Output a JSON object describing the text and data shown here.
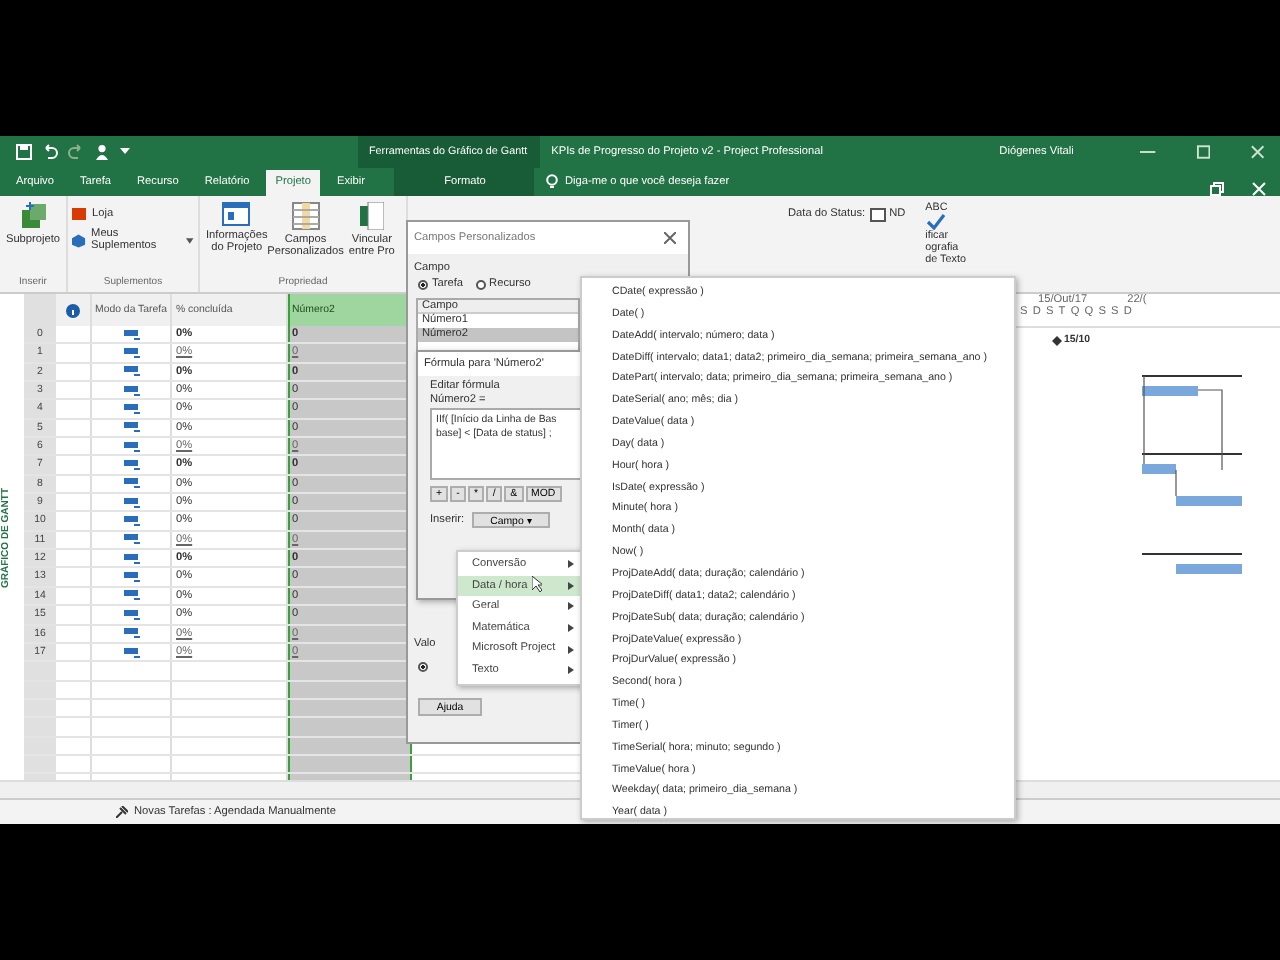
{
  "window": {
    "context_tab_group": "Ferramentas do Gráfico de Gantt",
    "title": "KPIs de Progresso do Projeto v2  -  Project Professional",
    "user": "Diógenes Vitali"
  },
  "ribbon_tabs": [
    {
      "label": "Arquivo",
      "selected": false
    },
    {
      "label": "Tarefa",
      "selected": false
    },
    {
      "label": "Recurso",
      "selected": false
    },
    {
      "label": "Relatório",
      "selected": false
    },
    {
      "label": "Projeto",
      "selected": true
    },
    {
      "label": "Exibir",
      "selected": false
    },
    {
      "label": "Formato",
      "selected": false
    }
  ],
  "tell_me": "Diga-me o que você deseja fazer",
  "ribbon": {
    "subprojeto": "Subprojeto",
    "loja": "Loja",
    "meus_suplementos": "Meus Suplementos",
    "informacoes": "Informações do Projeto",
    "campos": "Campos Personalizados",
    "vincular": "Vincular entre Pro",
    "data_status_label": "Data do Status:",
    "data_status_value": "ND",
    "abc": "ABC",
    "ortografia": [
      "ificar",
      "ografia",
      "de Texto"
    ],
    "groups": [
      "Inserir",
      "Suplementos",
      "Propriedad"
    ]
  },
  "side_label": "GRÁFICO DE GANTT",
  "table": {
    "columns": [
      "Modo da Tarefa",
      "% concluída",
      "Número2"
    ],
    "rows": [
      {
        "id": "0",
        "kind": "summary",
        "pct": "0%",
        "num": "0"
      },
      {
        "id": "1",
        "kind": "linked",
        "pct": "0%",
        "num": "0"
      },
      {
        "id": "2",
        "kind": "summary",
        "pct": "0%",
        "num": "0"
      },
      {
        "id": "3",
        "kind": "task",
        "pct": "0%",
        "num": "0"
      },
      {
        "id": "4",
        "kind": "task",
        "pct": "0%",
        "num": "0"
      },
      {
        "id": "5",
        "kind": "task",
        "pct": "0%",
        "num": "0"
      },
      {
        "id": "6",
        "kind": "linked",
        "pct": "0%",
        "num": "0"
      },
      {
        "id": "7",
        "kind": "summary",
        "pct": "0%",
        "num": "0"
      },
      {
        "id": "8",
        "kind": "task",
        "pct": "0%",
        "num": "0"
      },
      {
        "id": "9",
        "kind": "task",
        "pct": "0%",
        "num": "0"
      },
      {
        "id": "10",
        "kind": "task",
        "pct": "0%",
        "num": "0"
      },
      {
        "id": "11",
        "kind": "linked",
        "pct": "0%",
        "num": "0"
      },
      {
        "id": "12",
        "kind": "summary",
        "pct": "0%",
        "num": "0"
      },
      {
        "id": "13",
        "kind": "task",
        "pct": "0%",
        "num": "0"
      },
      {
        "id": "14",
        "kind": "task",
        "pct": "0%",
        "num": "0"
      },
      {
        "id": "15",
        "kind": "task",
        "pct": "0%",
        "num": "0"
      },
      {
        "id": "16",
        "kind": "linked",
        "pct": "0%",
        "num": "0"
      },
      {
        "id": "17",
        "kind": "linked",
        "pct": "0%",
        "num": "0"
      }
    ]
  },
  "gantt": {
    "week": "15/Out/17",
    "next_week": "22/(",
    "days": [
      "S",
      "D",
      "S",
      "T",
      "Q",
      "Q",
      "S",
      "S",
      "D"
    ],
    "milestone": "15/10"
  },
  "status_bar": "Novas Tarefas : Agendada Manualmente",
  "dialog": {
    "title": "Campos Personalizados",
    "campo_label": "Campo",
    "radios": [
      {
        "label": "Tarefa",
        "selected": true
      },
      {
        "label": "Recurso",
        "selected": false
      }
    ],
    "list_header": "Campo",
    "fields": [
      {
        "label": "Número1",
        "selected": false
      },
      {
        "label": "Número2",
        "selected": true
      }
    ],
    "valores": "Valo",
    "value_option": {
      "selected": true
    },
    "help": "Ajuda"
  },
  "formula": {
    "title": "Fórmula para 'Número2'",
    "edit_label": "Editar fórmula",
    "field_label": "Número2 =",
    "lines": [
      "IIf( [Início da Linha de Bas",
      "base] < [Data de status] ;"
    ],
    "operators": [
      "+",
      "-",
      "*",
      "/",
      "&",
      "MOD"
    ],
    "insert_label": "Inserir:",
    "insert_button": "Campo ▾"
  },
  "menu": [
    {
      "label": "Conversão",
      "selected": false
    },
    {
      "label": "Data / hora",
      "selected": true
    },
    {
      "label": "Geral",
      "selected": false
    },
    {
      "label": "Matemática",
      "selected": false
    },
    {
      "label": "Microsoft Project",
      "selected": false
    },
    {
      "label": "Texto",
      "selected": false
    }
  ],
  "functions": [
    "CDate( expressão )",
    "Date( )",
    "DateAdd( intervalo; número; data )",
    "DateDiff( intervalo; data1; data2; primeiro_dia_semana; primeira_semana_ano )",
    "DatePart( intervalo; data; primeiro_dia_semana; primeira_semana_ano )",
    "DateSerial( ano; mês; dia )",
    "DateValue( data )",
    "Day( data )",
    "Hour( hora )",
    "IsDate( expressão )",
    "Minute( hora )",
    "Month( data )",
    "Now( )",
    "ProjDateAdd( data; duração; calendário )",
    "ProjDateDiff( data1; data2; calendário )",
    "ProjDateSub( data; duração; calendário )",
    "ProjDateValue( expressão )",
    "ProjDurValue( expressão )",
    "Second( hora )",
    "Time( )",
    "Timer( )",
    "TimeSerial( hora; minuto; segundo )",
    "TimeValue( hora )",
    "Weekday( data; primeiro_dia_semana )",
    "Year( data )"
  ]
}
